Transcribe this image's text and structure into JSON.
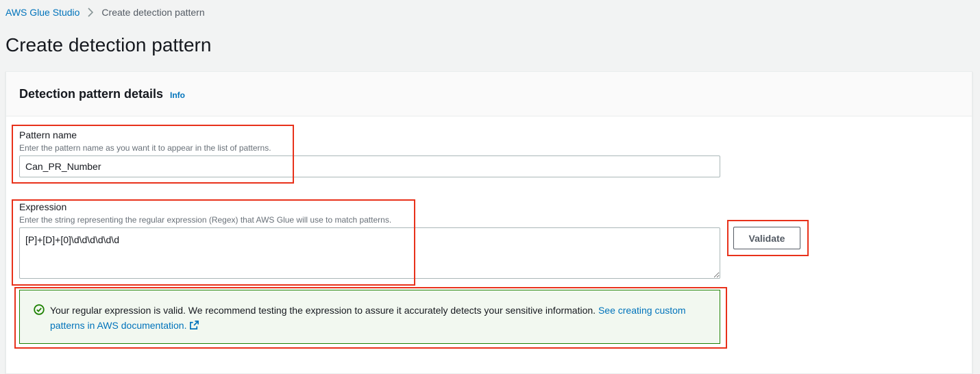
{
  "breadcrumb": {
    "root": "AWS Glue Studio",
    "current": "Create detection pattern"
  },
  "page": {
    "title": "Create detection pattern"
  },
  "panel": {
    "title": "Detection pattern details",
    "info_label": "Info"
  },
  "pattern_name": {
    "label": "Pattern name",
    "description": "Enter the pattern name as you want it to appear in the list of patterns.",
    "value": "Can_PR_Number"
  },
  "expression": {
    "label": "Expression",
    "description": "Enter the string representing the regular expression (Regex) that AWS Glue will use to match patterns.",
    "value": "[P]+[D]+[0]\\d\\d\\d\\d\\d\\d"
  },
  "validate_button": {
    "label": "Validate"
  },
  "alert": {
    "message": "Your regular expression is valid. We recommend testing the expression to assure it accurately detects your sensitive information.",
    "link_text": "See creating custom patterns in AWS documentation.",
    "icon": "success-check-circle-icon",
    "icon_secondary": "external-link-icon"
  },
  "colors": {
    "link": "#0073bb",
    "success": "#1d8102",
    "highlight": "#e8311a",
    "alert_bg": "#f2f8f0"
  }
}
